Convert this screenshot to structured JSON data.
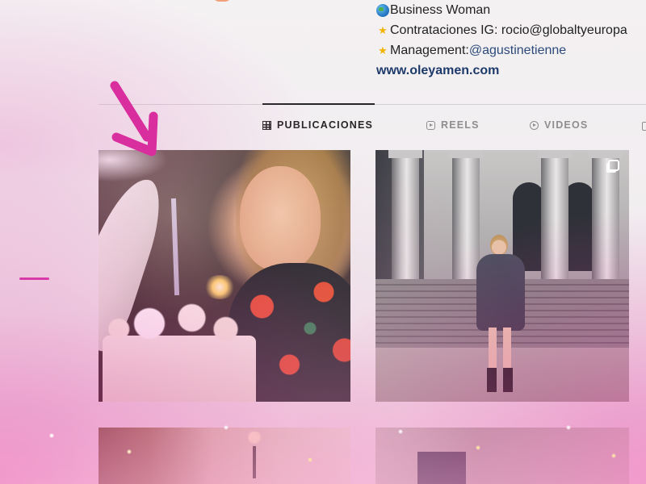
{
  "bio": {
    "line1_text": "Business Woman",
    "line2_text": "Contrataciones IG: rocio@globaltyeuropa",
    "line3_prefix": "Management: ",
    "line3_mention": "@agustinetienne",
    "website": "www.oleyamen.com",
    "line1_icon": "globe-icon",
    "line2_icon": "star-icon",
    "line3_icon": "star-icon"
  },
  "tabs": [
    {
      "label": "PUBLICACIONES",
      "icon": "grid-icon",
      "active": true
    },
    {
      "label": "REELS",
      "icon": "reels-icon",
      "active": false
    },
    {
      "label": "VIDEOS",
      "icon": "video-icon",
      "active": false
    }
  ],
  "posts": [
    {
      "description": "birthday-cake-photo"
    },
    {
      "description": "building-steps-photo"
    },
    {
      "description": "interior-lamp-photo"
    },
    {
      "description": "street-building-photo"
    }
  ],
  "colors": {
    "overlay_accent": "#d93aa8",
    "link_text": "#1e3a6a",
    "active_tab": "#262626",
    "inactive_tab": "#8e8e8e"
  }
}
